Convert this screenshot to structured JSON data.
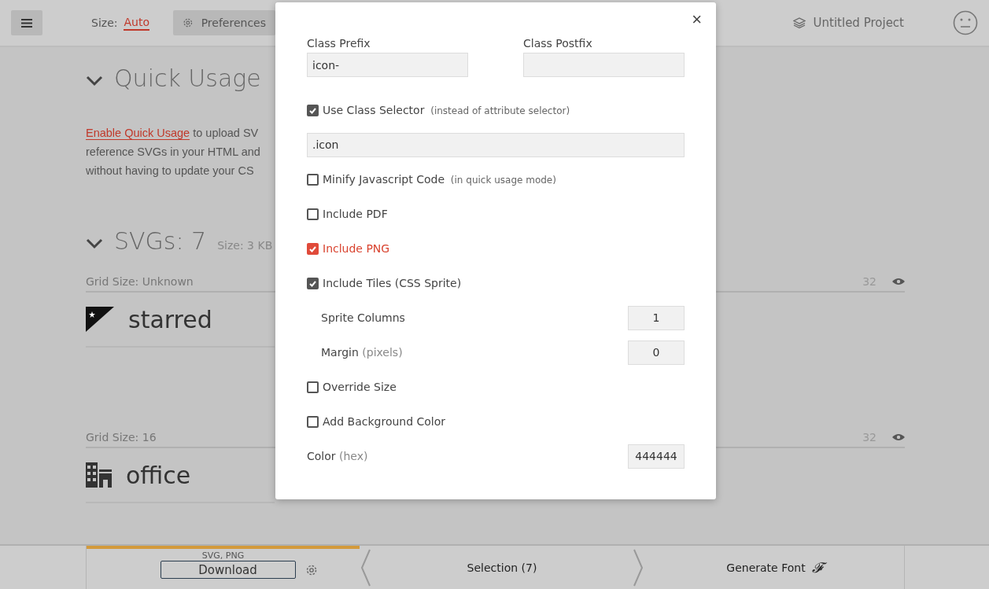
{
  "toolbar": {
    "size_label": "Size:",
    "size_value": "Auto",
    "preferences": "Preferences",
    "project": "Untitled Project"
  },
  "quick_usage": {
    "title": "Quick Usage",
    "link": "Enable Quick Usage",
    "text": " to upload SV",
    "lines": [
      "reference SVGs in your HTML and",
      "without having to update your CS"
    ]
  },
  "svgs": {
    "title": "SVGs: 7",
    "size": "Size: 3 KB"
  },
  "groups": [
    {
      "grid": "Grid Size: Unknown",
      "count": "32",
      "name": "starred"
    },
    {
      "grid": "Grid Size: 16",
      "count": "32",
      "name": "office"
    }
  ],
  "dialog": {
    "close": "×",
    "prefix_label": "Class Prefix",
    "prefix_value": "icon-",
    "postfix_label": "Class Postfix",
    "options": [
      {
        "kind": "check",
        "label": "Use Class Selector",
        "note": "(instead of attribute selector)",
        "checked": true,
        "highlight": false
      },
      {
        "kind": "field",
        "value": ".icon"
      },
      {
        "kind": "check",
        "label": "Minify Javascript Code",
        "note": "(in quick usage mode)",
        "checked": false,
        "highlight": false
      },
      {
        "kind": "check",
        "label": "Include PDF",
        "checked": false,
        "highlight": false
      },
      {
        "kind": "check",
        "label": "Include PNG",
        "checked": true,
        "highlight": true
      },
      {
        "kind": "check",
        "label": "Include Tiles (CSS Sprite)",
        "checked": true,
        "highlight": false
      },
      {
        "kind": "number",
        "label": "Sprite Columns",
        "value": "1",
        "indent": true
      },
      {
        "kind": "number",
        "label": "Margin",
        "note": "(pixels)",
        "value": "0",
        "indent": true
      },
      {
        "kind": "check",
        "label": "Override Size",
        "checked": false,
        "highlight": false
      },
      {
        "kind": "check",
        "label": "Add Background Color",
        "checked": false,
        "highlight": false
      },
      {
        "kind": "number",
        "label": "Color",
        "note": "(hex)",
        "value": "444444",
        "indent": false
      }
    ]
  },
  "footer": {
    "formats": "SVG, PNG",
    "download": "Download",
    "selection": "Selection (7)",
    "generate": "Generate Font",
    "generate_glyph": "𝓕"
  }
}
